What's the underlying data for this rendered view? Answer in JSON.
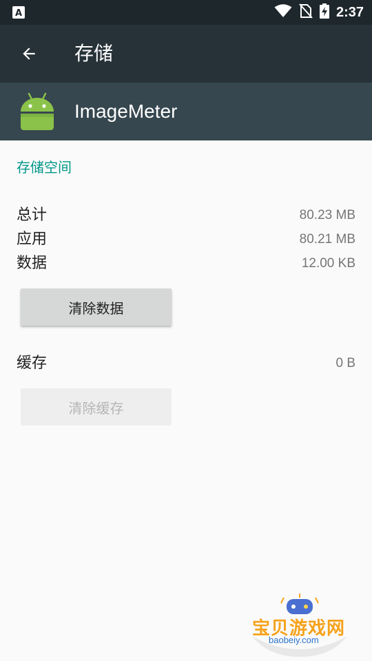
{
  "status_bar": {
    "time": "2:37",
    "notification_icon": "a-letter-notification-icon",
    "icons": [
      "wifi-icon",
      "no-sim-icon",
      "battery-charging-icon"
    ]
  },
  "app_bar": {
    "back_icon": "arrow-back-icon",
    "title": "存储"
  },
  "app_header": {
    "icon": "android-robot-icon",
    "app_name": "ImageMeter"
  },
  "storage": {
    "section_title": "存储空间",
    "rows": [
      {
        "label": "总计",
        "value": "80.23 MB"
      },
      {
        "label": "应用",
        "value": "80.21 MB"
      },
      {
        "label": "数据",
        "value": "12.00 KB"
      }
    ],
    "clear_data_label": "清除数据"
  },
  "cache": {
    "label": "缓存",
    "value": "0 B",
    "clear_cache_label": "清除缓存",
    "clear_cache_enabled": false
  },
  "watermark": {
    "text": "宝贝游戏网",
    "url": "baobeiy.com"
  },
  "colors": {
    "status_bar": "#1e272c",
    "app_bar": "#263238",
    "app_header": "#37474f",
    "accent": "#009688",
    "android_green": "#8bc34a"
  }
}
